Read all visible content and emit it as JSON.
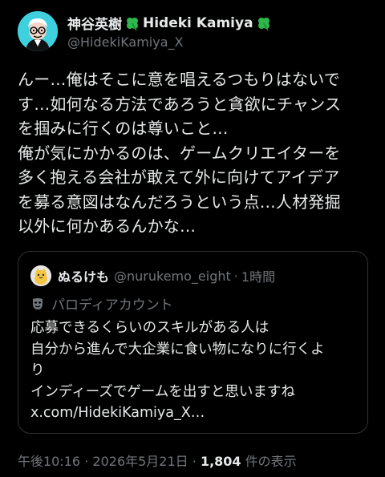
{
  "author": {
    "name": "神谷英樹",
    "name_en": "Hideki Kamiya",
    "handle": "@HidekiKamiya_X",
    "avatar_icon": "cartoon-face-avatar",
    "emoji_icon": "four-leaf-clover"
  },
  "tweet": {
    "text": "んー…俺はそこに意を唱えるつもりはないで\nす…如何なる方法であろうと貪欲にチャンス\nを掴みに行くのは尊いこと…\n俺が気にかかるのは、ゲームクリエイターを\n多く抱える会社が敢えて外に向けてアイデア\nを募る意図はなんだろうという点…人材発掘\n以外に何かあるんかな…"
  },
  "quote": {
    "name": "ぬるけも",
    "handle": "@nurukemo_eight",
    "separator": "·",
    "time": "1時間",
    "badge": "パロディアカウント",
    "badge_icon": "theater-mask-icon",
    "text": "応募できるくらいのスキルがある人は\n自分から進んで大企業に食い物になりに行くよ\nり\nインディーズでゲームを出すと思いますね\nx.com/HidekiKamiya_X…"
  },
  "meta": {
    "time": "午後10:16",
    "sep1": "·",
    "date": "2026年5月21日",
    "sep2": "·",
    "views_count": "1,804",
    "views_label": "件の表示"
  },
  "colors": {
    "background": "#000000",
    "text": "#e7e9ea",
    "muted": "#71767b",
    "border": "#2f3336",
    "clover": "#2db84b"
  }
}
